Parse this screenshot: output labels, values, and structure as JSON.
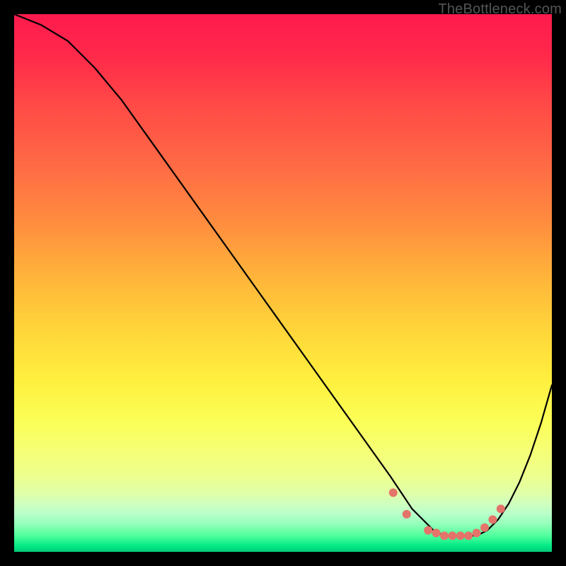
{
  "watermark": "TheBottleneck.com",
  "colors": {
    "marker": "#e4736a",
    "curve": "#000000"
  },
  "chart_data": {
    "type": "line",
    "title": "",
    "xlabel": "",
    "ylabel": "",
    "xlim": [
      0,
      100
    ],
    "ylim": [
      0,
      100
    ],
    "grid": false,
    "series": [
      {
        "name": "bottleneck-curve",
        "x": [
          0,
          5,
          10,
          15,
          20,
          25,
          30,
          35,
          40,
          45,
          50,
          55,
          60,
          65,
          70,
          72,
          74,
          76,
          78,
          80,
          82,
          84,
          86,
          88,
          90,
          92,
          94,
          96,
          98,
          100
        ],
        "y": [
          100,
          98,
          95,
          90,
          84,
          77,
          70,
          63,
          56,
          49,
          42,
          35,
          28,
          21,
          14,
          11,
          8,
          6,
          4,
          3,
          3,
          3,
          3,
          4,
          6,
          9,
          13,
          18,
          24,
          31
        ]
      }
    ],
    "markers": {
      "name": "highlight-dots",
      "x": [
        70.5,
        73,
        77,
        78.5,
        80,
        81.5,
        83,
        84.5,
        86,
        87.5,
        89,
        90.5
      ],
      "y": [
        11,
        7,
        4,
        3.5,
        3,
        3,
        3,
        3,
        3.5,
        4.5,
        6,
        8
      ]
    }
  }
}
